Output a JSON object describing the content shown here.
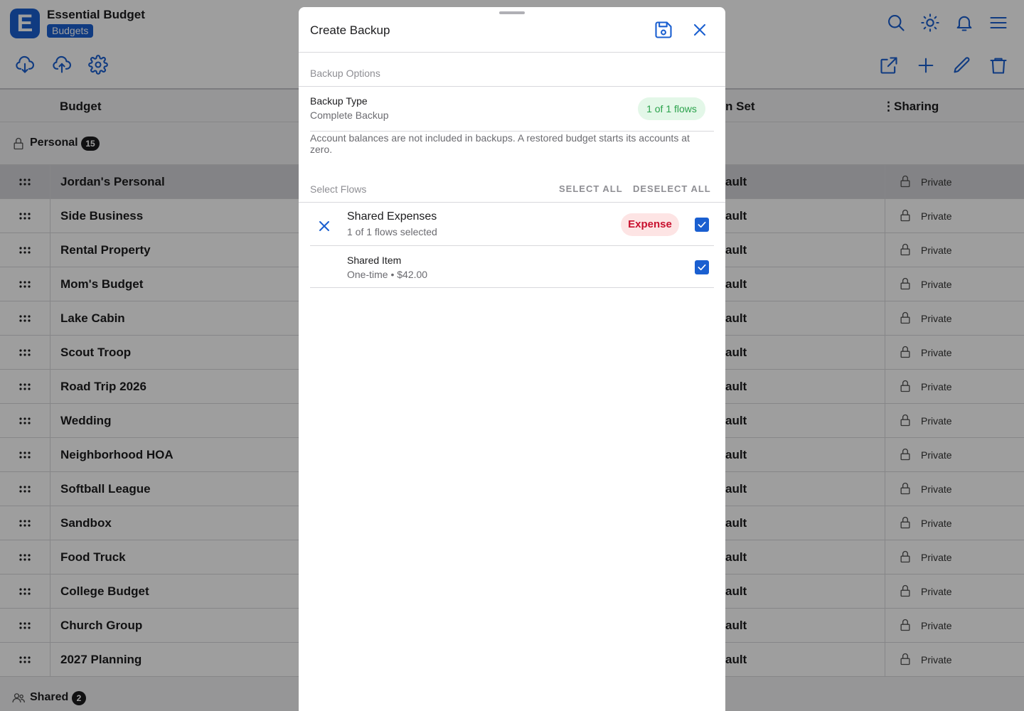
{
  "app": {
    "logo_letter": "E",
    "name": "Essential Budget",
    "section": "Budgets"
  },
  "toolbar": {
    "left_icons": [
      "cloud-download-icon",
      "cloud-upload-icon",
      "gear-icon"
    ],
    "right_top_icons": [
      "search-icon",
      "sun-icon",
      "bell-icon",
      "menu-icon"
    ],
    "right_actions": [
      "open-external-icon",
      "plus-icon",
      "pencil-icon",
      "trash-icon"
    ]
  },
  "table": {
    "columns": {
      "budget": "Budget",
      "icon_set_partial": "n Set",
      "sharing": "Sharing"
    },
    "groups": [
      {
        "label": "Personal",
        "count": "15"
      },
      {
        "label": "Shared",
        "count": "2"
      }
    ],
    "rows": [
      {
        "name": "Jordan's Personal",
        "icon_set": "ault",
        "sharing": "Private"
      },
      {
        "name": "Side Business",
        "icon_set": "ault",
        "sharing": "Private"
      },
      {
        "name": "Rental Property",
        "icon_set": "ault",
        "sharing": "Private"
      },
      {
        "name": "Mom's Budget",
        "icon_set": "ault",
        "sharing": "Private"
      },
      {
        "name": "Lake Cabin",
        "icon_set": "ault",
        "sharing": "Private"
      },
      {
        "name": "Scout Troop",
        "icon_set": "ault",
        "sharing": "Private"
      },
      {
        "name": "Road Trip 2026",
        "icon_set": "ault",
        "sharing": "Private"
      },
      {
        "name": "Wedding",
        "icon_set": "ault",
        "sharing": "Private"
      },
      {
        "name": "Neighborhood HOA",
        "icon_set": "ault",
        "sharing": "Private"
      },
      {
        "name": "Softball League",
        "icon_set": "ault",
        "sharing": "Private"
      },
      {
        "name": "Sandbox",
        "icon_set": "ault",
        "sharing": "Private"
      },
      {
        "name": "Food Truck",
        "icon_set": "ault",
        "sharing": "Private"
      },
      {
        "name": "College Budget",
        "icon_set": "ault",
        "sharing": "Private"
      },
      {
        "name": "Church Group",
        "icon_set": "ault",
        "sharing": "Private"
      },
      {
        "name": "2027 Planning",
        "icon_set": "ault",
        "sharing": "Private"
      }
    ]
  },
  "sheet": {
    "title": "Create Backup",
    "backup_options_label": "Backup Options",
    "backup_type_title": "Backup Type",
    "backup_type_value": "Complete Backup",
    "flows_pill": "1 of 1 flows",
    "note": "Account balances are not included in backups. A restored budget starts its accounts at zero.",
    "select_flows_label": "Select Flows",
    "select_all": "SELECT ALL",
    "deselect_all": "DESELECT ALL",
    "flow": {
      "name": "Shared Expenses",
      "sub": "1 of 1 flows selected",
      "tag": "Expense",
      "checked": true
    },
    "item": {
      "name": "Shared Item",
      "sub": "One-time • $42.00",
      "checked": true
    }
  },
  "colors": {
    "accent": "#1a5fd0",
    "expense_text": "#c8102e",
    "expense_bg": "#fde4e4",
    "flows_pill_text": "#2ba24c",
    "flows_pill_bg": "#e3f7e8"
  }
}
